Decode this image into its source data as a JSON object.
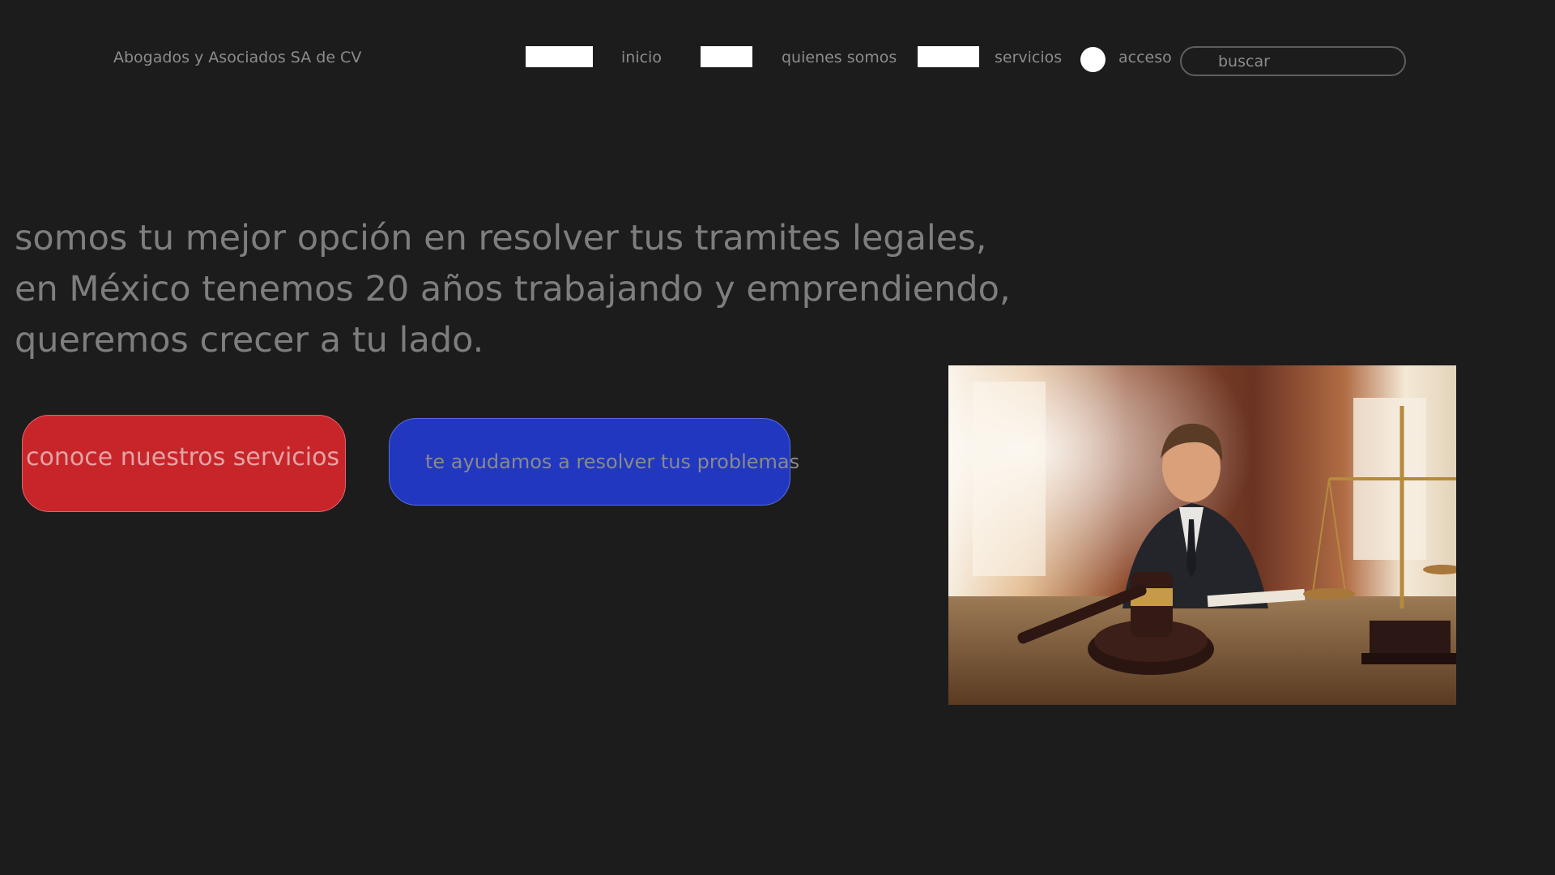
{
  "header": {
    "brand": "Abogados y Asociados SA de CV",
    "nav": [
      {
        "label": "inicio"
      },
      {
        "label": "quienes somos"
      },
      {
        "label": "servicios"
      },
      {
        "label": "acceso"
      }
    ],
    "search": {
      "placeholder": "buscar"
    }
  },
  "hero": {
    "lines": [
      "somos tu mejor opción en resolver tus tramites legales,",
      "en México tenemos 20 años trabajando y emprendiendo,",
      "queremos crecer a tu lado."
    ]
  },
  "actions": {
    "primary_label": "conoce nuestros servicios",
    "secondary_label": "te ayudamos a resolver tus problemas"
  },
  "image": {
    "subject": "lawyer-with-gavel-and-scales-photo"
  },
  "colors": {
    "background": "#1c1c1c",
    "primary_button": "#c8252a",
    "secondary_button": "#2137c0",
    "text_muted": "#8c8c8c"
  }
}
